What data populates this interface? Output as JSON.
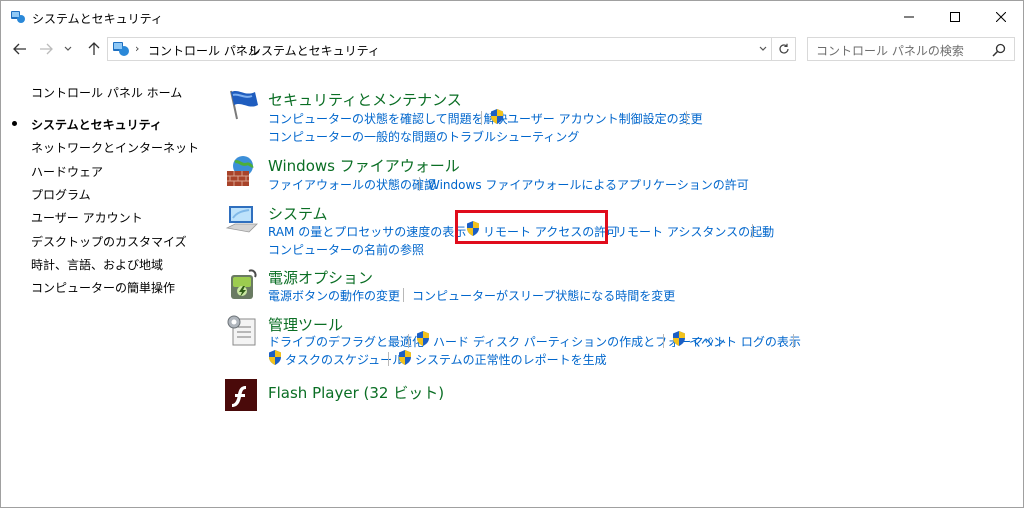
{
  "window": {
    "title": "システムとセキュリティ"
  },
  "address": {
    "crumbs": [
      "コントロール パネル",
      "システムとセキュリティ"
    ],
    "search_placeholder": "コントロール パネルの検索"
  },
  "leftnav": {
    "home": "コントロール パネル ホーム",
    "items": [
      {
        "label": "システムとセキュリティ",
        "current": true
      },
      {
        "label": "ネットワークとインターネット",
        "current": false
      },
      {
        "label": "ハードウェア",
        "current": false
      },
      {
        "label": "プログラム",
        "current": false
      },
      {
        "label": "ユーザー アカウント",
        "current": false
      },
      {
        "label": "デスクトップのカスタマイズ",
        "current": false
      },
      {
        "label": "時計、言語、および地域",
        "current": false
      },
      {
        "label": "コンピューターの簡単操作",
        "current": false
      }
    ]
  },
  "categories": {
    "security": {
      "title": "セキュリティとメンテナンス",
      "links": [
        "コンピューターの状態を確認して問題を解決",
        "ユーザー アカウント制御設定の変更",
        "コンピューターの一般的な問題のトラブルシューティング"
      ]
    },
    "firewall": {
      "title": "Windows ファイアウォール",
      "links": [
        "ファイアウォールの状態の確認",
        "Windows ファイアウォールによるアプリケーションの許可"
      ]
    },
    "system": {
      "title": "システム",
      "links": [
        "RAM の量とプロセッサの速度の表示",
        "リモート アクセスの許可",
        "リモート アシスタンスの起動",
        "コンピューターの名前の参照"
      ]
    },
    "power": {
      "title": "電源オプション",
      "links": [
        "電源ボタンの動作の変更",
        "コンピューターがスリープ状態になる時間を変更"
      ]
    },
    "admin": {
      "title": "管理ツール",
      "links": [
        "ドライブのデフラグと最適化",
        "ハード ディスク パーティションの作成とフォーマット",
        "イベント ログの表示",
        "タスクのスケジュール",
        "システムの正常性のレポートを生成"
      ]
    },
    "flash": {
      "title": "Flash Player (32 ビット)"
    }
  },
  "colors": {
    "link": "#0066cc",
    "category_title": "#0a6e24",
    "highlight": "#e00c1c"
  }
}
